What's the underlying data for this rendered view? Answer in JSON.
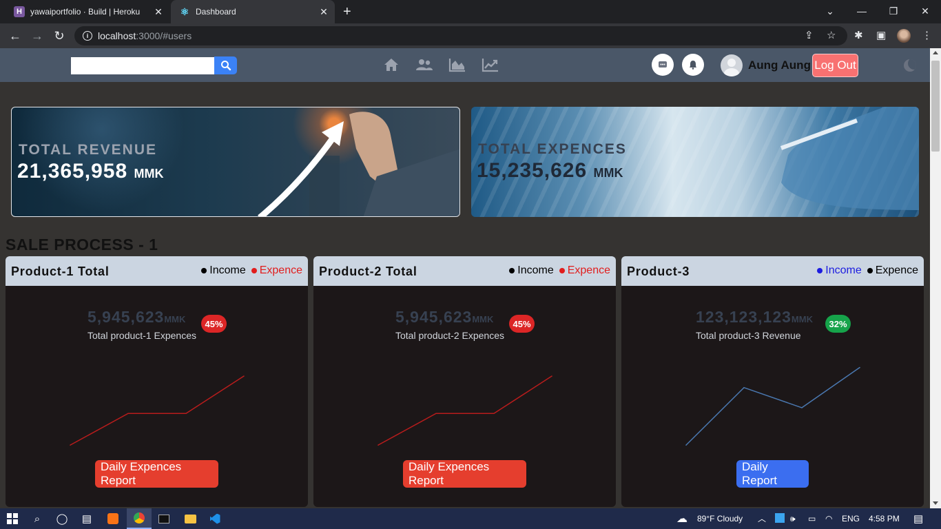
{
  "browser": {
    "tabs": [
      {
        "title": "yawaiportfolio · Build | Heroku",
        "active": false
      },
      {
        "title": "Dashboard",
        "active": true
      }
    ],
    "url_host": "localhost",
    "url_path": ":3000/#users"
  },
  "header": {
    "search_placeholder": "",
    "user_name": "Aung Aung",
    "logout_label": "Log Out"
  },
  "banners": {
    "revenue": {
      "label": "TOTAL REVENUE",
      "amount": "21,365,958",
      "unit": "MMK"
    },
    "expences": {
      "label": "TOTAL EXPENCES",
      "amount": "15,235,626",
      "unit": "MMK"
    }
  },
  "section_title": "SALE PROCESS - 1",
  "cards": [
    {
      "title": "Product-1 Total",
      "legend": [
        {
          "label": "Income",
          "color": "#000000"
        },
        {
          "label": "Expence",
          "color": "#e11d1d"
        }
      ],
      "value": "5,945,623",
      "unit": "MMK",
      "caption": "Total product-1 Expences",
      "percent": "45%",
      "badge_color": "#dc2626",
      "line_color": "#b91c1c",
      "series": [
        1,
        3.2,
        3.2,
        5.8
      ],
      "button_label": "Daily Expences Report",
      "button_color": "#e53e2e"
    },
    {
      "title": "Product-2 Total",
      "legend": [
        {
          "label": "Income",
          "color": "#000000"
        },
        {
          "label": "Expence",
          "color": "#e11d1d"
        }
      ],
      "value": "5,945,623",
      "unit": "MMK",
      "caption": "Total product-2 Expences",
      "percent": "45%",
      "badge_color": "#dc2626",
      "line_color": "#b91c1c",
      "series": [
        1,
        3.2,
        3.2,
        5.8
      ],
      "button_label": "Daily Expences Report",
      "button_color": "#e53e2e"
    },
    {
      "title": "Product-3",
      "legend": [
        {
          "label": "Income",
          "color": "#1d1de0"
        },
        {
          "label": "Expence",
          "color": "#000000"
        }
      ],
      "value": "123,123,123",
      "unit": "MMK",
      "caption": "Total product-3 Revenue",
      "percent": "32%",
      "badge_color": "#16a34a",
      "line_color": "#4a78b0",
      "series": [
        1,
        5,
        3.6,
        6.4
      ],
      "button_label": "Daily Report",
      "button_color": "#3b6ef0"
    }
  ],
  "taskbar": {
    "weather": "89°F  Cloudy",
    "language": "ENG",
    "time": "4:58 PM"
  }
}
